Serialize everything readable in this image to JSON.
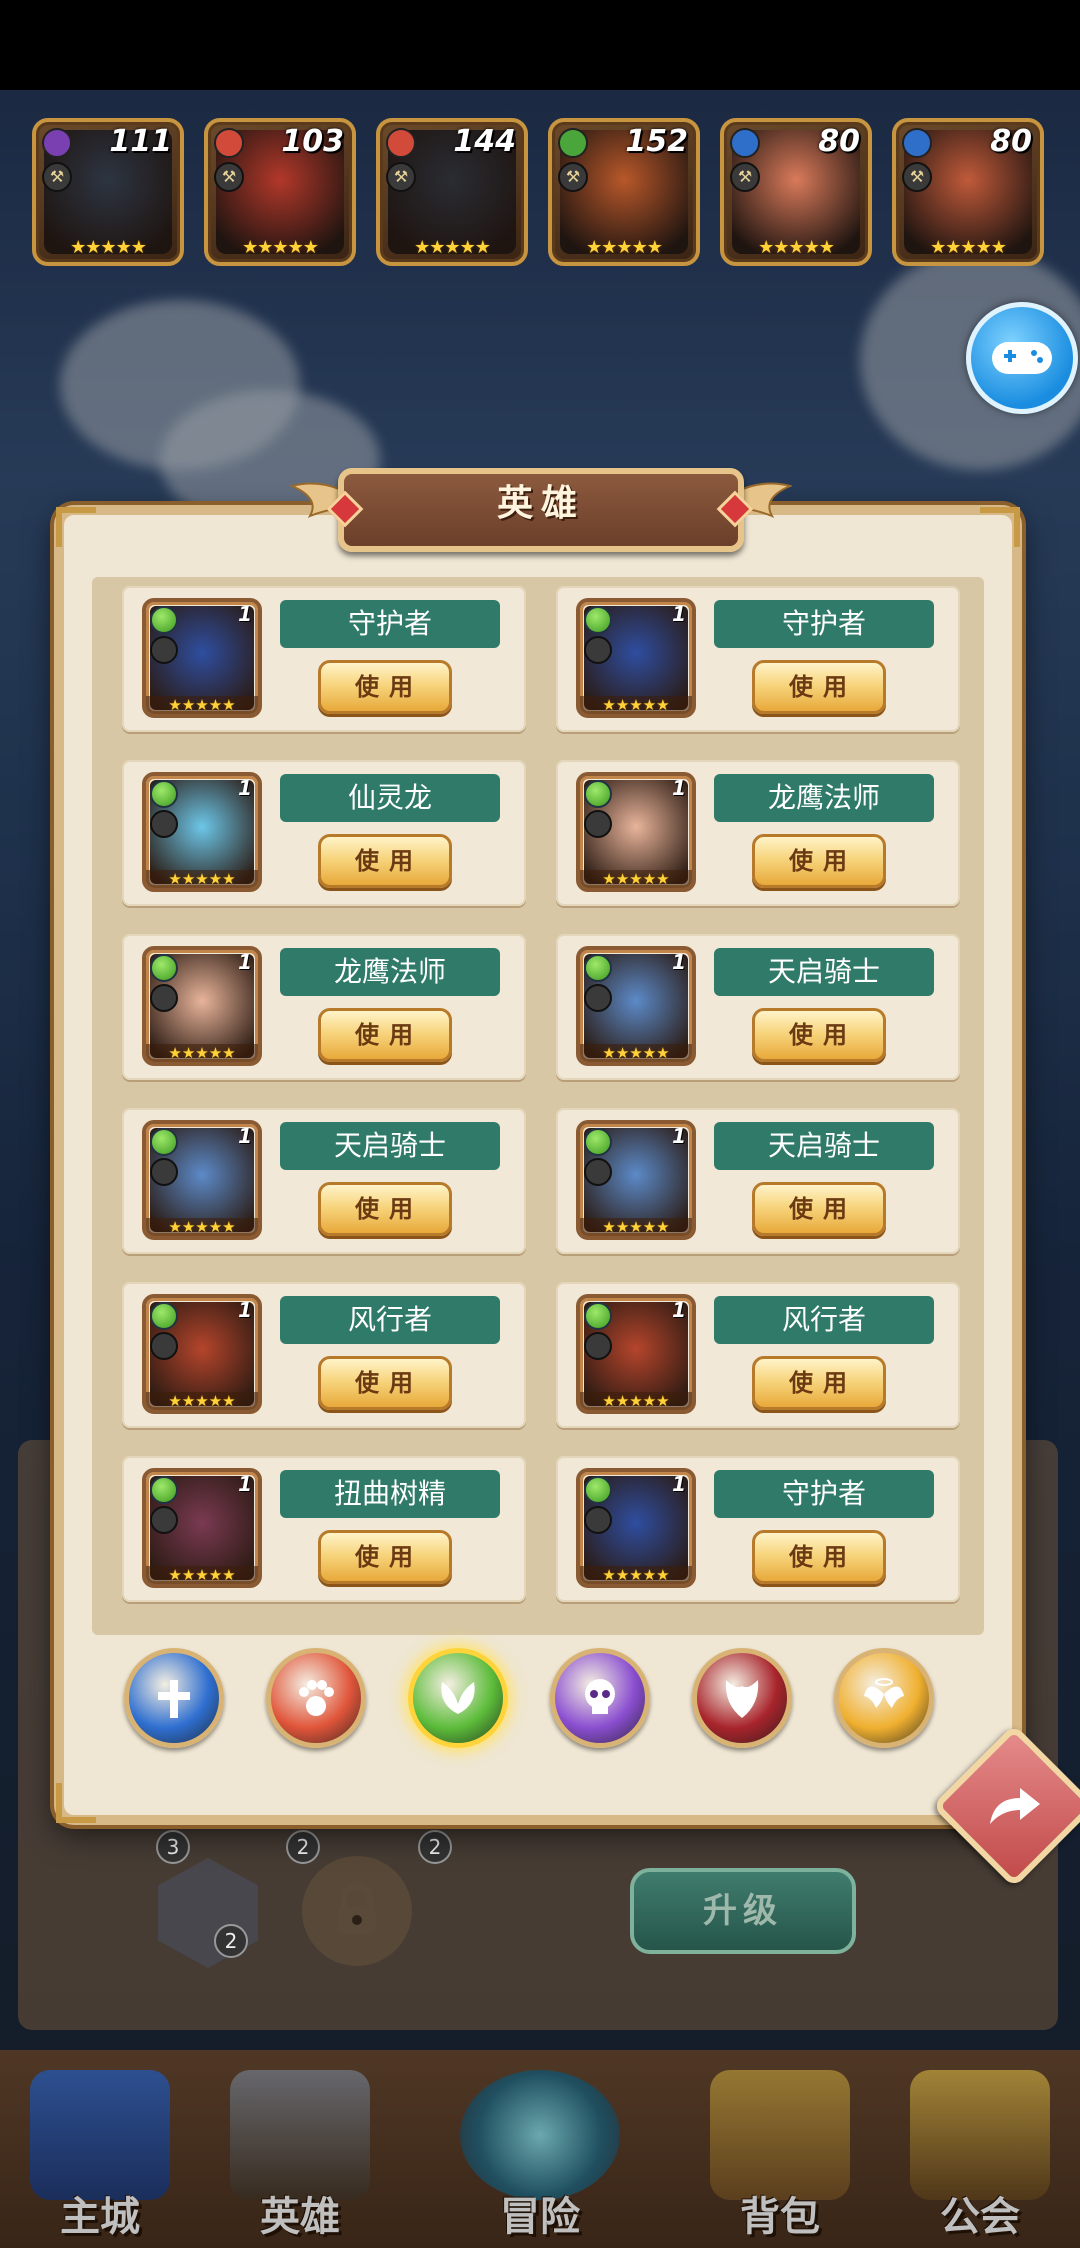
{
  "roster": [
    {
      "level": "111",
      "faction_color": "#7a3fb0",
      "portrait_color": "#2d3542"
    },
    {
      "level": "103",
      "faction_color": "#d14a3a",
      "portrait_color": "#b2382a"
    },
    {
      "level": "144",
      "faction_color": "#d14a3a",
      "portrait_color": "#2a2c33"
    },
    {
      "level": "152",
      "faction_color": "#4aa63a",
      "portrait_color": "#b8582a"
    },
    {
      "level": "80",
      "faction_color": "#2f6fc9",
      "portrait_color": "#d97a5a"
    },
    {
      "level": "80",
      "faction_color": "#2f6fc9",
      "portrait_color": "#c05a3a"
    }
  ],
  "dialog": {
    "title": "英雄",
    "use_label": "使用",
    "heroes": [
      {
        "name": "守护者",
        "face_color": "#2f4ea0",
        "num": "1"
      },
      {
        "name": "守护者",
        "face_color": "#2f4ea0",
        "num": "1"
      },
      {
        "name": "仙灵龙",
        "face_color": "#6cc6e8",
        "num": "1"
      },
      {
        "name": "龙鹰法师",
        "face_color": "#e8b49a",
        "num": "1"
      },
      {
        "name": "龙鹰法师",
        "face_color": "#e8b49a",
        "num": "1"
      },
      {
        "name": "天启骑士",
        "face_color": "#5c8ac8",
        "num": "1"
      },
      {
        "name": "天启骑士",
        "face_color": "#5c8ac8",
        "num": "1"
      },
      {
        "name": "天启骑士",
        "face_color": "#5c8ac8",
        "num": "1"
      },
      {
        "name": "风行者",
        "face_color": "#b5452c",
        "num": "1"
      },
      {
        "name": "风行者",
        "face_color": "#b5452c",
        "num": "1"
      },
      {
        "name": "扭曲树精",
        "face_color": "#7a3a52",
        "num": "1"
      },
      {
        "name": "守护者",
        "face_color": "#2f4ea0",
        "num": "1"
      }
    ]
  },
  "factions": [
    {
      "name": "holy-cross",
      "color": "#2f6fd0",
      "selected": false
    },
    {
      "name": "beast-paw",
      "color": "#e0553a",
      "selected": false
    },
    {
      "name": "nature-wings",
      "color": "#5cbc3a",
      "selected": true
    },
    {
      "name": "skull",
      "color": "#8a4ed0",
      "selected": false
    },
    {
      "name": "demon-face",
      "color": "#a8242c",
      "selected": false
    },
    {
      "name": "angel-wings",
      "color": "#f0b030",
      "selected": false
    }
  ],
  "background": {
    "upgrade_label": "升级",
    "slot_counts": [
      "3",
      "2",
      "2",
      "2"
    ]
  },
  "nav": [
    {
      "label": "主城"
    },
    {
      "label": "英雄"
    },
    {
      "label": "冒险"
    },
    {
      "label": "背包"
    },
    {
      "label": "公会"
    }
  ]
}
